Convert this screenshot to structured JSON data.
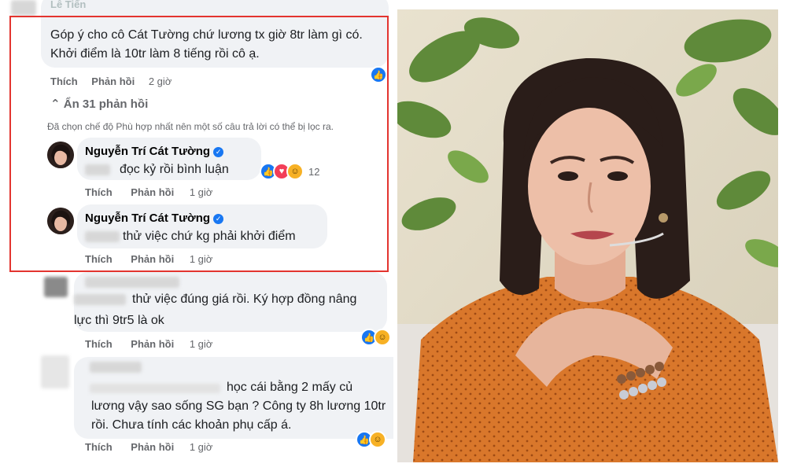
{
  "thread": {
    "top_comment": {
      "author": "Lê Tiến",
      "line1": "Góp ý cho cô Cát Tường chứ lương tx giờ 8tr làm gì có.",
      "line2": "Khởi điểm là 10tr làm 8 tiếng rồi cô ạ.",
      "like_label": "Thích",
      "reply_label": "Phản hồi",
      "time": "2 giờ"
    },
    "hide_replies": "Ẩn 31 phản hồi",
    "filter_note": "Đã chọn chế độ Phù hợp nhất nên một số câu trả lời có thể bị lọc ra.",
    "reply1": {
      "author": "Nguyễn Trí Cát Tường",
      "text": "đọc kỷ rồi bình luận",
      "reaction_count": "12",
      "like_label": "Thích",
      "reply_label": "Phản hồi",
      "time": "1 giờ"
    },
    "reply2": {
      "author": "Nguyễn Trí Cát Tường",
      "text": "thử việc chứ kg phải khởi điểm",
      "like_label": "Thích",
      "reply_label": "Phản hồi",
      "time": "1 giờ"
    },
    "comment3": {
      "line1": "thử việc đúng giá rồi. Ký hợp đồng nâng",
      "line2": "lực thì 9tr5 là ok",
      "like_label": "Thích",
      "reply_label": "Phản hồi",
      "time": "1 giờ"
    },
    "comment4": {
      "line1": "học cái bằng 2 mấy củ",
      "line2": "lương vậy sao sống SG bạn ? Công ty 8h lương 10tr",
      "line3": "rồi. Chưa tính các khoản phụ cấp á.",
      "like_label": "Thích",
      "reply_label": "Phản hồi",
      "time": "1 giờ"
    }
  },
  "colors": {
    "highlight_border": "#e3342f",
    "bubble": "#f0f2f5",
    "verified": "#1877f2",
    "meta_text": "#65676b",
    "shirt": "#d9772b",
    "background_green": "#5f8a3a"
  }
}
